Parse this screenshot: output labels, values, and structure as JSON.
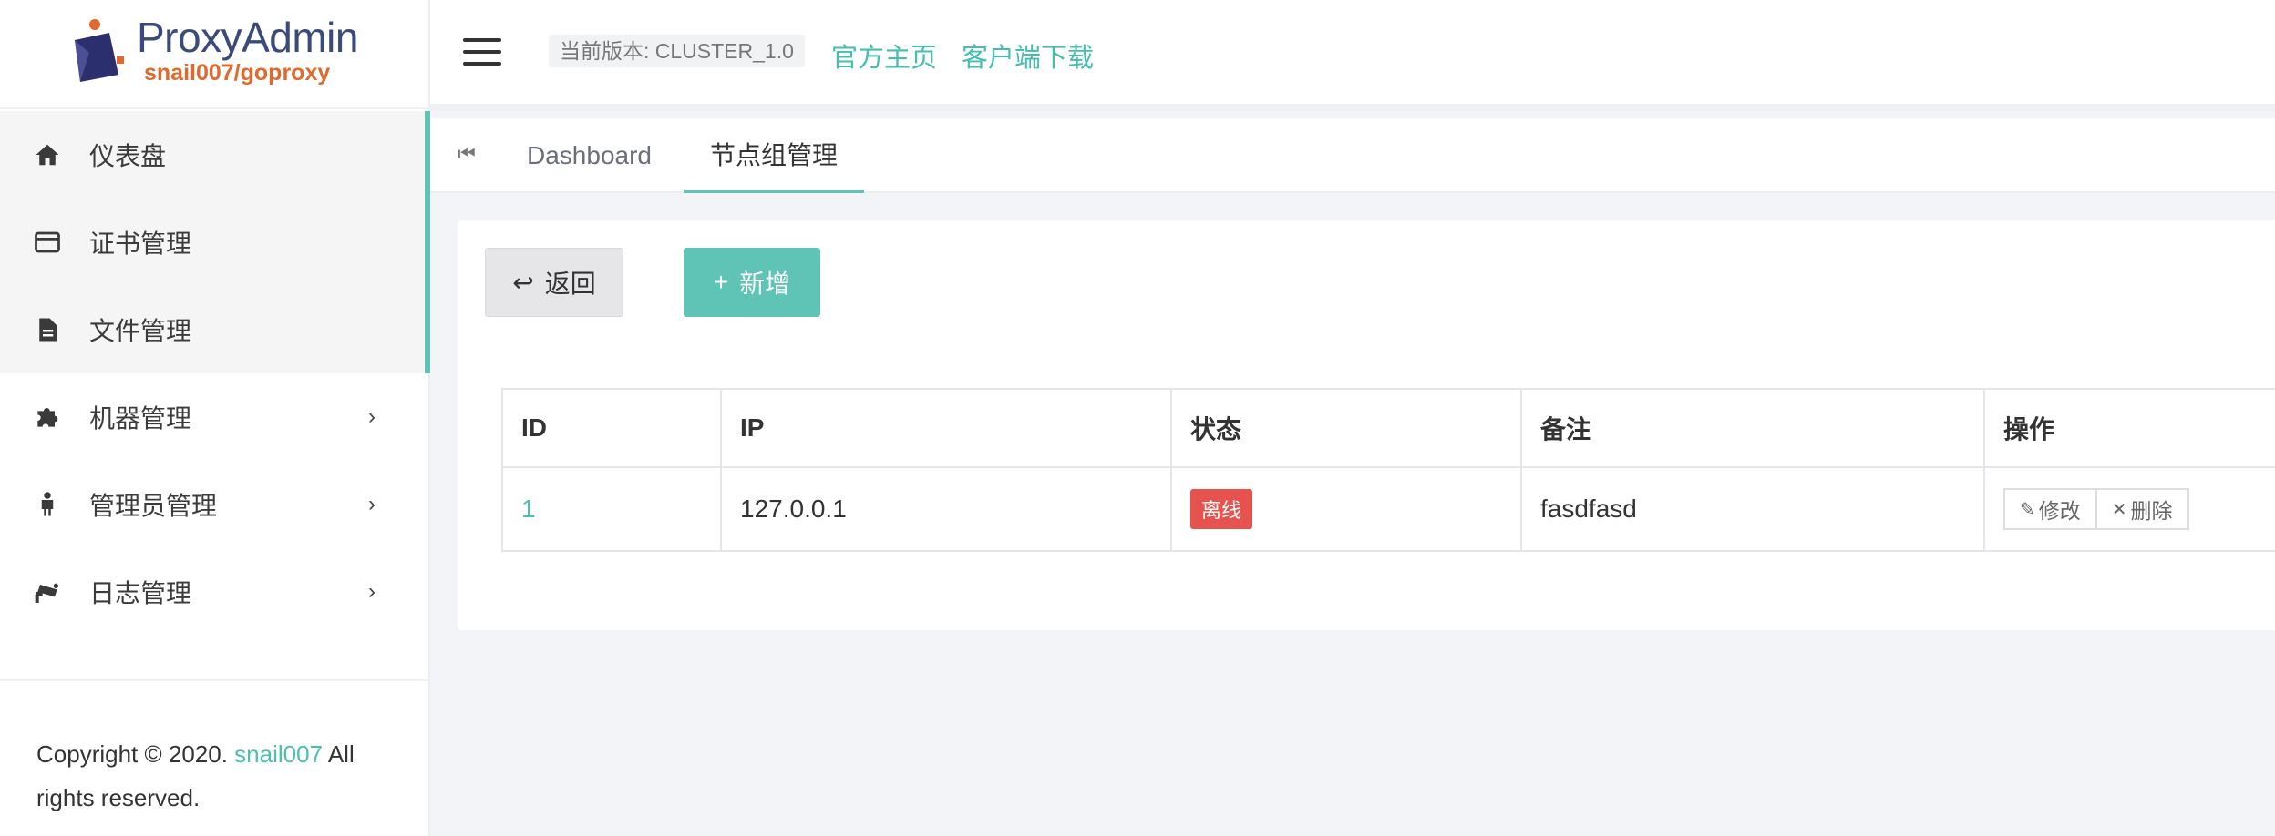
{
  "brand": {
    "title": "ProxyAdmin",
    "subtitle": "snail007/goproxy"
  },
  "sidebar": {
    "items": [
      {
        "label": "仪表盘",
        "icon": "home-icon"
      },
      {
        "label": "证书管理",
        "icon": "credit-card-icon"
      },
      {
        "label": "文件管理",
        "icon": "file-icon"
      },
      {
        "label": "机器管理",
        "icon": "puzzle-icon",
        "arrow": "›"
      },
      {
        "label": "管理员管理",
        "icon": "person-icon",
        "arrow": "›"
      },
      {
        "label": "日志管理",
        "icon": "camera-icon",
        "arrow": "›"
      }
    ],
    "footer": {
      "prefix": "Copyright © 2020. ",
      "link": "snail007",
      "suffix": " All rights reserved."
    }
  },
  "header": {
    "version": "当前版本: CLUSTER_1.0",
    "links": [
      "官方主页",
      "客户端下载"
    ]
  },
  "tabs": {
    "items": [
      "Dashboard",
      "节点组管理"
    ]
  },
  "toolbar": {
    "back_label": "返回",
    "add_label": "新增"
  },
  "table": {
    "columns": [
      "ID",
      "IP",
      "状态",
      "备注",
      "操作"
    ],
    "rows": [
      {
        "id": "1",
        "ip": "127.0.0.1",
        "status": "离线",
        "note": "fasdfasd"
      }
    ],
    "actions": {
      "edit": "修改",
      "delete": "删除"
    }
  },
  "colors": {
    "accent": "#5fc3b5",
    "link": "#45bfad",
    "danger": "#e6534f",
    "brand_orange": "#e06a2e"
  }
}
